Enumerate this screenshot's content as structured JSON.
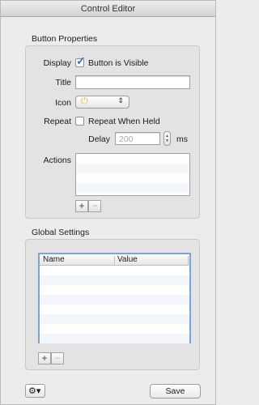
{
  "window": {
    "title": "Control Editor"
  },
  "button_properties": {
    "section_label": "Button Properties",
    "display": {
      "label": "Display",
      "checkbox_label": "Button is Visible",
      "checked": true
    },
    "title": {
      "label": "Title",
      "value": ""
    },
    "icon": {
      "label": "Icon",
      "selected_icon": "power-icon",
      "arrows": "⇕"
    },
    "repeat": {
      "label": "Repeat",
      "checkbox_label": "Repeat When Held",
      "checked": false
    },
    "delay": {
      "label": "Delay",
      "placeholder": "200",
      "unit": "ms"
    },
    "actions": {
      "label": "Actions",
      "add_label": "+",
      "remove_label": "−"
    }
  },
  "global_settings": {
    "section_label": "Global Settings",
    "columns": [
      "Name",
      "Value"
    ],
    "add_label": "+",
    "remove_label": "−"
  },
  "footer": {
    "gear_menu": "⚙▾",
    "save_label": "Save"
  },
  "colors": {
    "accent": "#2a6fd6",
    "icon_yellow": "#e1b83c",
    "window_bg": "#ececec",
    "group_bg": "#e3e3e3"
  }
}
